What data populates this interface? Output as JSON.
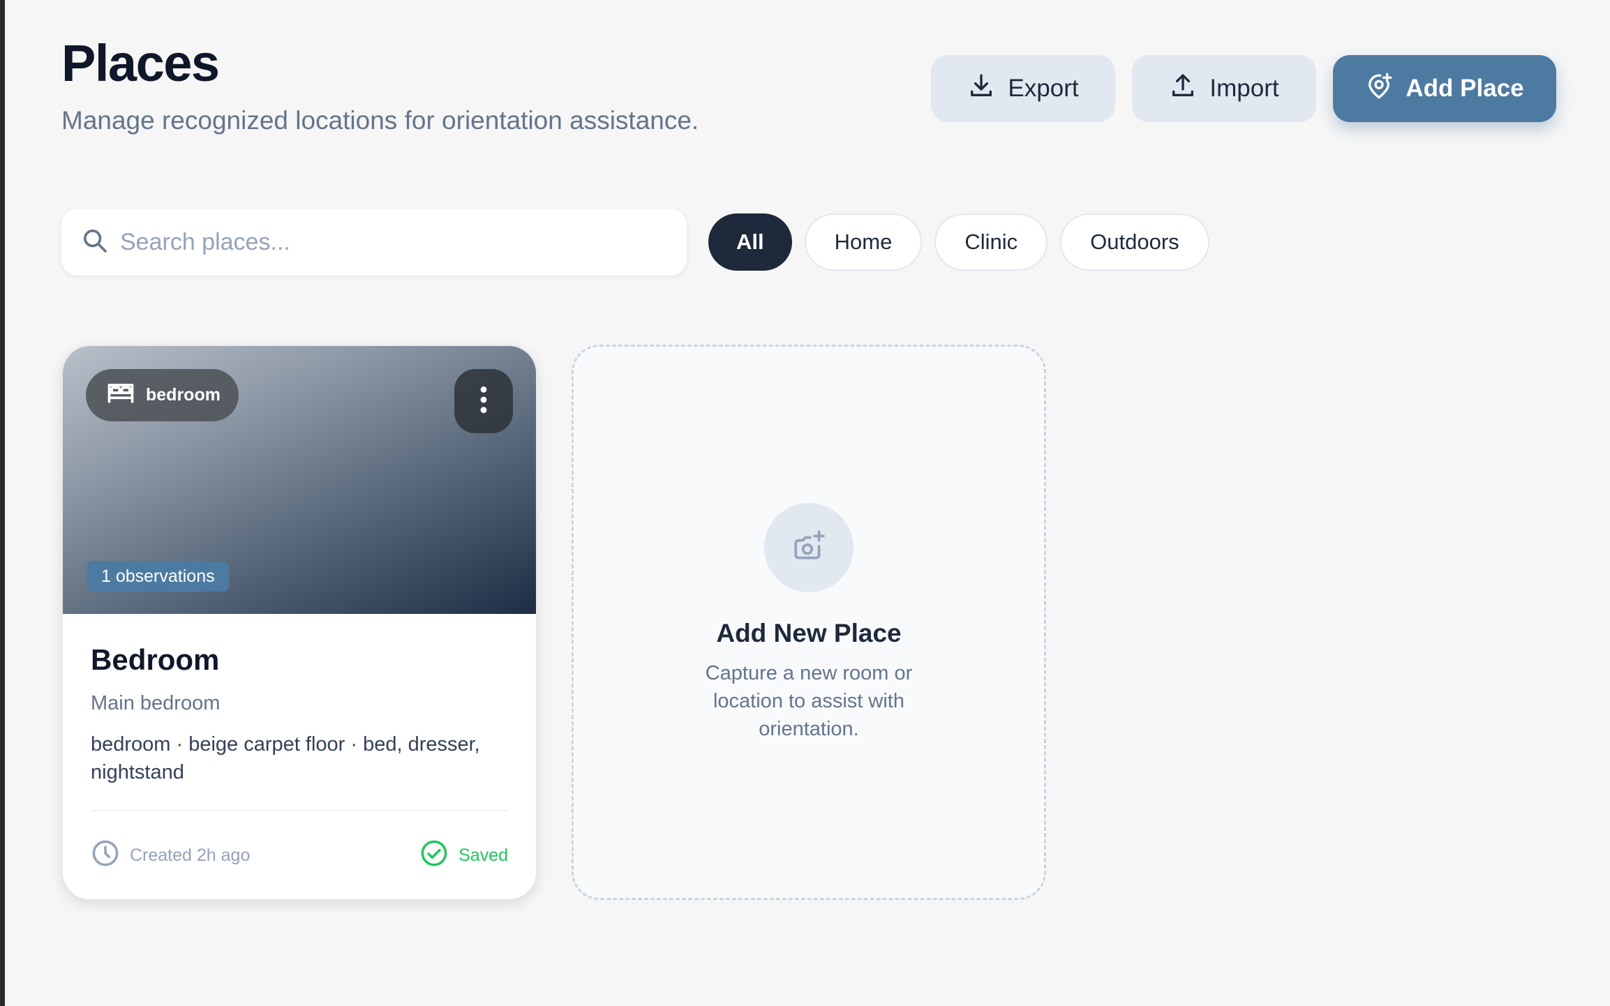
{
  "header": {
    "title": "Places",
    "subtitle": "Manage recognized locations for orientation assistance.",
    "actions": {
      "export_label": "Export",
      "import_label": "Import",
      "add_place_label": "Add Place"
    }
  },
  "search": {
    "placeholder": "Search places...",
    "value": ""
  },
  "filters": [
    {
      "label": "All",
      "active": true
    },
    {
      "label": "Home",
      "active": false
    },
    {
      "label": "Clinic",
      "active": false
    },
    {
      "label": "Outdoors",
      "active": false
    }
  ],
  "places": [
    {
      "type_badge": "bedroom",
      "type_icon": "bed-icon",
      "observations": "1 observations",
      "name": "Bedroom",
      "description": "Main bedroom",
      "features": "bedroom · beige carpet floor · bed, dresser, nightstand",
      "created": "Created 2h ago",
      "status": "Saved"
    }
  ],
  "add_card": {
    "title": "Add New Place",
    "description": "Capture a new room or location to assist with orientation."
  },
  "colors": {
    "primary": "#4d7aa1",
    "dark": "#1e293b",
    "success": "#22c55e",
    "muted": "#64748b",
    "background": "#f6f6f6"
  }
}
